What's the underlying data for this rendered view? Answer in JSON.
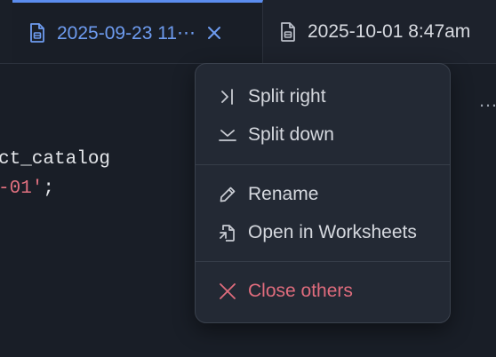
{
  "tabs": [
    {
      "label": "2025-09-23 11⋯",
      "icon": "document-icon",
      "active": true,
      "close_icon": "close-icon"
    },
    {
      "label": "2025-10-01 8:47am",
      "icon": "document-icon",
      "active": false
    }
  ],
  "editor": {
    "lines": [
      {
        "text": "ct_catalog"
      },
      {
        "string_part": "-01'",
        "punc_part": ";"
      }
    ],
    "overflow_indicator": "…"
  },
  "context_menu": {
    "items": [
      {
        "label": "Split right",
        "icon": "split-right-icon",
        "danger": false
      },
      {
        "label": "Split down",
        "icon": "split-down-icon",
        "danger": false
      },
      {
        "label": "Rename",
        "icon": "pencil-icon",
        "danger": false
      },
      {
        "label": "Open in Worksheets",
        "icon": "open-in-file-icon",
        "danger": false
      },
      {
        "label": "Close others",
        "icon": "close-icon",
        "danger": true
      }
    ]
  },
  "colors": {
    "accent": "#5b8def",
    "active_tab_text": "#6e9cf0",
    "danger": "#e06c7d",
    "string": "#e0707f",
    "menu_background": "#232934",
    "editor_background": "#191e27"
  }
}
